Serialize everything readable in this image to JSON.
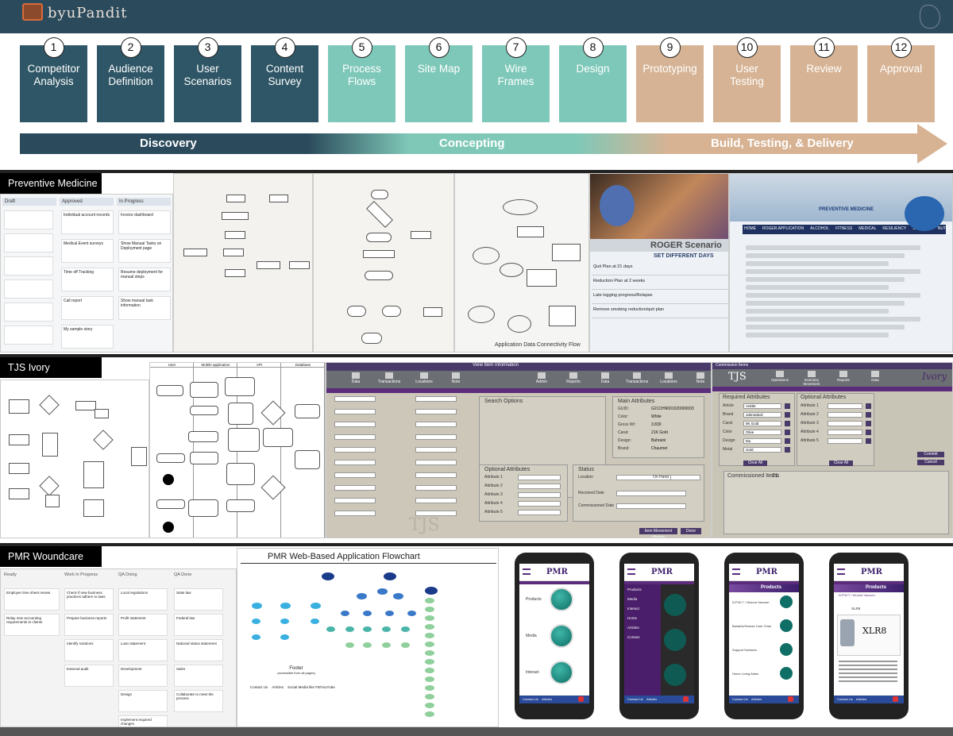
{
  "logo_text": "byuPandit",
  "steps": [
    {
      "num": "1",
      "label": "Competitor Analysis"
    },
    {
      "num": "2",
      "label": "Audience Definition"
    },
    {
      "num": "3",
      "label": "User Scenarios"
    },
    {
      "num": "4",
      "label": "Content Survey"
    },
    {
      "num": "5",
      "label": "Process Flows"
    },
    {
      "num": "6",
      "label": "Site Map"
    },
    {
      "num": "7",
      "label": "Wire Frames"
    },
    {
      "num": "8",
      "label": "Design"
    },
    {
      "num": "9",
      "label": "Prototyping"
    },
    {
      "num": "10",
      "label": "User Testing"
    },
    {
      "num": "11",
      "label": "Review"
    },
    {
      "num": "12",
      "label": "Approval"
    }
  ],
  "phases": {
    "discovery": "Discovery",
    "concepting": "Concepting",
    "build": "Build, Testing, & Delivery"
  },
  "sections": {
    "preventive": "Preventive Medicine",
    "tjs": "TJS Ivory",
    "pmr": "PMR Woundcare"
  },
  "preventive": {
    "kanban_cols": [
      "Draft",
      "Approved",
      "In Progress"
    ],
    "kanban_items": [
      "Individual account records",
      "Invoice dashboard",
      "Medical Event surveys",
      "Show Manual Tasks on Deployment page",
      "Time off Tracking",
      "Resume deployment for manual steps",
      "Call report",
      "Show manual task information",
      "My sample story"
    ],
    "roger_title": "ROGER Scenario",
    "roger_set": "SET DIFFERENT DAYS",
    "roger_rows": [
      "Quit Plan at 21 days",
      "Reduction Plan at 2 weeks",
      "Late logging progress/Relapse",
      "Remove smoking reduction/quit plan"
    ],
    "pm_brand": "PREVENTIVE MEDICINE",
    "pm_nav": [
      "HOME",
      "ROGER APPLICATION",
      "ALCOHOL",
      "FITNESS",
      "MEDICAL",
      "RESILIENCY",
      "SMOKING",
      "NUTRITION",
      "S.W.I.L.E.S"
    ],
    "diagram_caption": "Application Data Connectivity Flow"
  },
  "tjs": {
    "swim_cols": [
      "User",
      "Mobile application",
      "API",
      "Database"
    ],
    "view_title": "View Item Information",
    "nav": [
      "Data",
      "Transactions",
      "Locations",
      "Note",
      "Admin",
      "Reports",
      "Data",
      "Transactions",
      "Locations",
      "Note"
    ],
    "search_options": "Search Options",
    "main_attributes": "Main Attributes",
    "attr_fields": [
      "GUID:",
      "Color:",
      "Gross Wt:",
      "Carat:",
      "Design:",
      "Brand:"
    ],
    "attr_values": [
      "G21CHN001020000003",
      "White",
      "3.830",
      "21K Gold",
      "Bahraini",
      "Chaumet"
    ],
    "optional_attrs": "Optional Attributes",
    "status": "Status",
    "status_fields": [
      "Location",
      "On Hand",
      "Received Date",
      "Commissioned Date"
    ],
    "attribute_labels": [
      "Attribute 1",
      "Attribute 2",
      "Attribute 3",
      "Attribute 4",
      "Attribute 5"
    ],
    "buttons": [
      "Item Movement History",
      "Done"
    ],
    "commission_title": "Commission Items",
    "tjs_logo": "TJS",
    "ivory_logo": "Ivory",
    "tabs2": [
      "Operations",
      "Inventory Movement",
      "Reports",
      "Data"
    ],
    "required_attrs": "Required Attributes",
    "req_fields": [
      "Article",
      "Brand",
      "Carat",
      "Color",
      "Design",
      "Metal"
    ],
    "req_values": [
      "Anklet",
      "Jakrotakoil",
      "9K Gold",
      "Olive",
      "6tu",
      "Gold"
    ],
    "clear_all": "Clear All",
    "commissioned_items": "Commissioned Items",
    "commissioned_count": "21",
    "right_buttons": [
      "Commit",
      "Cancel"
    ]
  },
  "pmr": {
    "flow_title": "PMR Web-Based Application Flowchart",
    "footer_label": "Footer",
    "footer_sub": "(accessible from all pages)",
    "footer_items": [
      "Contact Us",
      "Articles",
      "Social Media like FB/YouTube"
    ],
    "kanban_cols": [
      "Ready",
      "Work in Progress",
      "QA Doing",
      "QA Done"
    ],
    "kanban_items": [
      "Check if new business practices adhere to laws",
      "Prepare business reports",
      "Identify solutions",
      "Local regulations",
      "Profit statement",
      "Loan statement",
      "State law",
      "Federal law",
      "National status statement",
      "Development",
      "Design",
      "Sales",
      "Implement required changes",
      "Collaborate to meet the process",
      "Employer time sheet review",
      "External audit",
      "Relay new accounting requirements to clients"
    ],
    "app_brand": "PMR",
    "menu_items": [
      "Products",
      "Media",
      "Interact"
    ],
    "products_title": "Products",
    "subtitle": "N.P.W.T / Wound Vacuum",
    "product_list": [
      "N.P.W.T. / Wound Vacuum",
      "Bariatric/Human Care Chair",
      "Support Surfaces",
      "Home Living Aides"
    ],
    "xlr": "XLR8",
    "footer_links": [
      "Contact Us",
      "Articles"
    ],
    "drawer_items": [
      "Products",
      "Media",
      "Interact",
      "Home",
      "Articles",
      "Contact"
    ]
  }
}
